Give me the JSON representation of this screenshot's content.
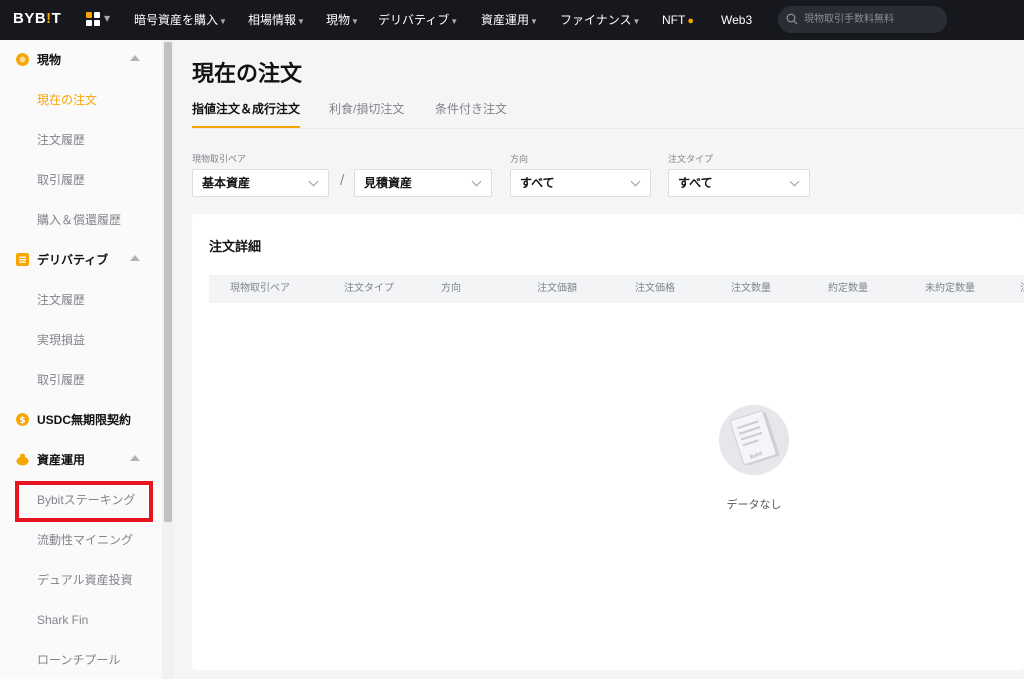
{
  "topnav": {
    "logo": "BYB",
    "logo_mark": "!",
    "logo_end": "T",
    "items": [
      {
        "label": "暗号資産を購入",
        "caret": true
      },
      {
        "label": "相場情報",
        "caret": true
      },
      {
        "label": "現物",
        "caret": true
      },
      {
        "label": "デリバティブ",
        "caret": true
      },
      {
        "label": "資産運用",
        "caret": true
      },
      {
        "label": "ファイナンス",
        "caret": true
      },
      {
        "label": "NFT",
        "caret": false
      },
      {
        "label": "Web3",
        "caret": false
      }
    ],
    "search_placeholder": "現物取引手数料無料"
  },
  "sidebar": {
    "sections": [
      {
        "label": "現物",
        "icon": "spot-icon",
        "color": "#f7a600"
      },
      {
        "label": "デリバティブ",
        "icon": "derivatives-icon",
        "color": "#f7a600"
      },
      {
        "label": "USDC無期限契約",
        "icon": "usdc-icon",
        "color": "#f7a600"
      },
      {
        "label": "資産運用",
        "icon": "earn-icon",
        "color": "#f7a600"
      }
    ],
    "items": [
      {
        "label": "現在の注文",
        "active": true
      },
      {
        "label": "注文履歴"
      },
      {
        "label": "取引履歴"
      },
      {
        "label": "購入＆償還履歴"
      },
      {
        "label": "注文履歴"
      },
      {
        "label": "実現損益"
      },
      {
        "label": "取引履歴"
      },
      {
        "label": "Bybitステーキング"
      },
      {
        "label": "流動性マイニング"
      },
      {
        "label": "デュアル資産投資"
      },
      {
        "label": "Shark Fin"
      },
      {
        "label": "ローンチプール"
      }
    ]
  },
  "main": {
    "title": "現在の注文",
    "tabs": [
      "指値注文＆成行注文",
      "利食/損切注文",
      "条件付き注文"
    ],
    "filters": {
      "pair_label": "現物取引ペア",
      "base": "基本資産",
      "quote": "見積資産",
      "separator": "/",
      "direction_label": "方向",
      "direction_value": "すべて",
      "type_label": "注文タイプ",
      "type_value": "すべて"
    },
    "panel_title": "注文詳細",
    "columns": [
      "現物取引ペア",
      "注文タイプ",
      "方向",
      "注文価額",
      "注文価格",
      "注文数量",
      "約定数量",
      "未約定数量",
      "注"
    ],
    "empty_text": "データなし",
    "empty_icon_text": "Bybit"
  },
  "colors": {
    "accent": "#f7a600",
    "nav_bg": "#17181e",
    "highlight": "#e8141f"
  }
}
